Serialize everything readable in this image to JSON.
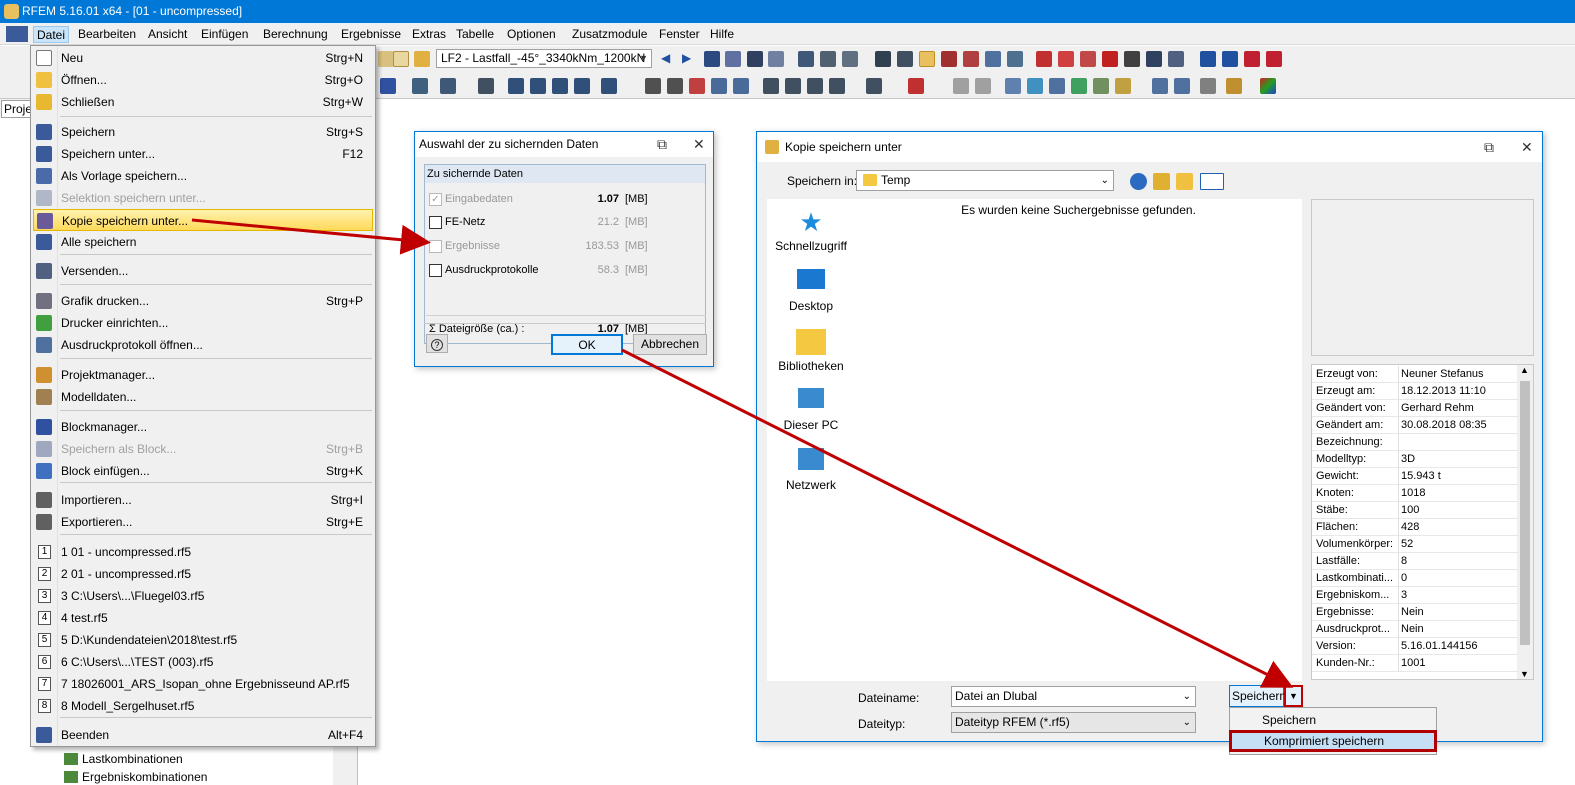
{
  "window": {
    "title": "RFEM 5.16.01 x64 - [01 - uncompressed]"
  },
  "menubar": {
    "items": [
      "Datei",
      "Bearbeiten",
      "Ansicht",
      "Einfügen",
      "Berechnung",
      "Ergebnisse",
      "Extras",
      "Tabelle",
      "Optionen",
      "Zusatzmodule",
      "Fenster",
      "Hilfe"
    ]
  },
  "toolbar": {
    "loadcase": "LF2 - Lastfall_-45°_3340kNm_1200kN"
  },
  "left_panel": {
    "tab": "Proje",
    "tree": [
      "Lastkombinationen",
      "Ergebniskombinationen"
    ]
  },
  "file_menu": {
    "items": [
      {
        "label": "Neu",
        "shortcut": "Strg+N",
        "icon": "new-file-icon"
      },
      {
        "label": "Öffnen...",
        "shortcut": "Strg+O",
        "icon": "open-folder-icon"
      },
      {
        "label": "Schließen",
        "shortcut": "Strg+W",
        "icon": "close-folder-icon"
      },
      {
        "label": "Speichern",
        "shortcut": "Strg+S",
        "icon": "save-icon"
      },
      {
        "label": "Speichern unter...",
        "shortcut": "F12",
        "icon": "save-as-icon"
      },
      {
        "label": "Als Vorlage speichern...",
        "shortcut": "",
        "icon": "template-icon"
      },
      {
        "label": "Selektion speichern unter...",
        "shortcut": "",
        "icon": "save-selection-icon",
        "disabled": true
      },
      {
        "label": "Kopie speichern unter...",
        "shortcut": "",
        "icon": "save-copy-icon",
        "highlighted": true
      },
      {
        "label": "Alle speichern",
        "shortcut": "",
        "icon": "save-all-icon"
      },
      {
        "label": "Versenden...",
        "shortcut": "",
        "icon": "send-icon"
      },
      {
        "label": "Grafik drucken...",
        "shortcut": "Strg+P",
        "icon": "print-icon"
      },
      {
        "label": "Drucker einrichten...",
        "shortcut": "",
        "icon": "printer-setup-icon"
      },
      {
        "label": "Ausdruckprotokoll öffnen...",
        "shortcut": "",
        "icon": "printout-report-icon"
      },
      {
        "label": "Projektmanager...",
        "shortcut": "",
        "icon": "project-manager-icon"
      },
      {
        "label": "Modelldaten...",
        "shortcut": "",
        "icon": "model-data-icon"
      },
      {
        "label": "Blockmanager...",
        "shortcut": "",
        "icon": "block-manager-icon"
      },
      {
        "label": "Speichern als Block...",
        "shortcut": "Strg+B",
        "icon": "save-block-icon",
        "disabled": true
      },
      {
        "label": "Block einfügen...",
        "shortcut": "Strg+K",
        "icon": "insert-block-icon"
      },
      {
        "label": "Importieren...",
        "shortcut": "Strg+I",
        "icon": "import-icon"
      },
      {
        "label": "Exportieren...",
        "shortcut": "Strg+E",
        "icon": "export-icon"
      },
      {
        "label": "1 01 - uncompressed.rf5",
        "shortcut": "",
        "num": "1"
      },
      {
        "label": "2 01 - uncompressed.rf5",
        "shortcut": "",
        "num": "2"
      },
      {
        "label": "3 C:\\Users\\...\\Fluegel03.rf5",
        "shortcut": "",
        "num": "3"
      },
      {
        "label": "4 test.rf5",
        "shortcut": "",
        "num": "4"
      },
      {
        "label": "5 D:\\Kundendateien\\2018\\test.rf5",
        "shortcut": "",
        "num": "5"
      },
      {
        "label": "6 C:\\Users\\...\\TEST (003).rf5",
        "shortcut": "",
        "num": "6"
      },
      {
        "label": "7 18026001_ARS_Isopan_ohne Ergebnisseund AP.rf5",
        "shortcut": "",
        "num": "7"
      },
      {
        "label": "8 Modell_Sergelhuset.rf5",
        "shortcut": "",
        "num": "8"
      },
      {
        "label": "Beenden",
        "shortcut": "Alt+F4",
        "icon": "exit-icon"
      }
    ]
  },
  "select_dialog": {
    "title": "Auswahl der zu sichernden Daten",
    "group_title": "Zu sichernde Daten",
    "rows": [
      {
        "label": "Eingabedaten",
        "value": "1.07",
        "unit": "[MB]",
        "checked": true,
        "disabled": true
      },
      {
        "label": "FE-Netz",
        "value": "21.2",
        "unit": "[MB]",
        "checked": false,
        "disabled": false
      },
      {
        "label": "Ergebnisse",
        "value": "183.53",
        "unit": "[MB]",
        "checked": false,
        "disabled": true
      },
      {
        "label": "Ausdruckprotokolle",
        "value": "58.3",
        "unit": "[MB]",
        "checked": false,
        "disabled": false
      }
    ],
    "sum_label": "Σ Dateigröße (ca.) :",
    "sum_value": "1.07",
    "sum_unit": "[MB]",
    "ok": "OK",
    "cancel": "Abbrechen"
  },
  "save_dialog": {
    "title": "Kopie speichern unter",
    "save_in_label": "Speichern in:",
    "save_in_value": "Temp",
    "places": [
      "Schnellzugriff",
      "Desktop",
      "Bibliotheken",
      "Dieser PC",
      "Netzwerk"
    ],
    "empty_message": "Es wurden keine Suchergebnisse gefunden.",
    "properties": [
      {
        "k": "Erzeugt von:",
        "v": "Neuner Stefanus"
      },
      {
        "k": "Erzeugt am:",
        "v": "18.12.2013 11:10"
      },
      {
        "k": "Geändert von:",
        "v": "Gerhard Rehm"
      },
      {
        "k": "Geändert am:",
        "v": "30.08.2018 08:35"
      },
      {
        "k": "Bezeichnung:",
        "v": ""
      },
      {
        "k": "Modelltyp:",
        "v": "3D"
      },
      {
        "k": "Gewicht:",
        "v": "15.943 t"
      },
      {
        "k": "Knoten:",
        "v": "1018"
      },
      {
        "k": "Stäbe:",
        "v": "100"
      },
      {
        "k": "Flächen:",
        "v": "428"
      },
      {
        "k": "Volumenkörper:",
        "v": "52"
      },
      {
        "k": "Lastfälle:",
        "v": "8"
      },
      {
        "k": "Lastkombinati...",
        "v": "0"
      },
      {
        "k": "Ergebniskom...",
        "v": "3"
      },
      {
        "k": "Ergebnisse:",
        "v": "Nein"
      },
      {
        "k": "Ausdruckprot...",
        "v": "Nein"
      },
      {
        "k": "Version:",
        "v": "5.16.01.144156"
      },
      {
        "k": "Kunden-Nr.:",
        "v": "1001"
      }
    ],
    "filename_label": "Dateiname:",
    "filename_value": "Datei an Dlubal",
    "filetype_label": "Dateityp:",
    "filetype_value": "Dateityp RFEM (*.rf5)",
    "save_button": "Speichern",
    "dropdown": [
      "Speichern",
      "Komprimiert speichern"
    ]
  },
  "colors": {
    "titlebar": "#0078d7",
    "highlight": "#ffd95a",
    "annotation": "#c00000"
  }
}
